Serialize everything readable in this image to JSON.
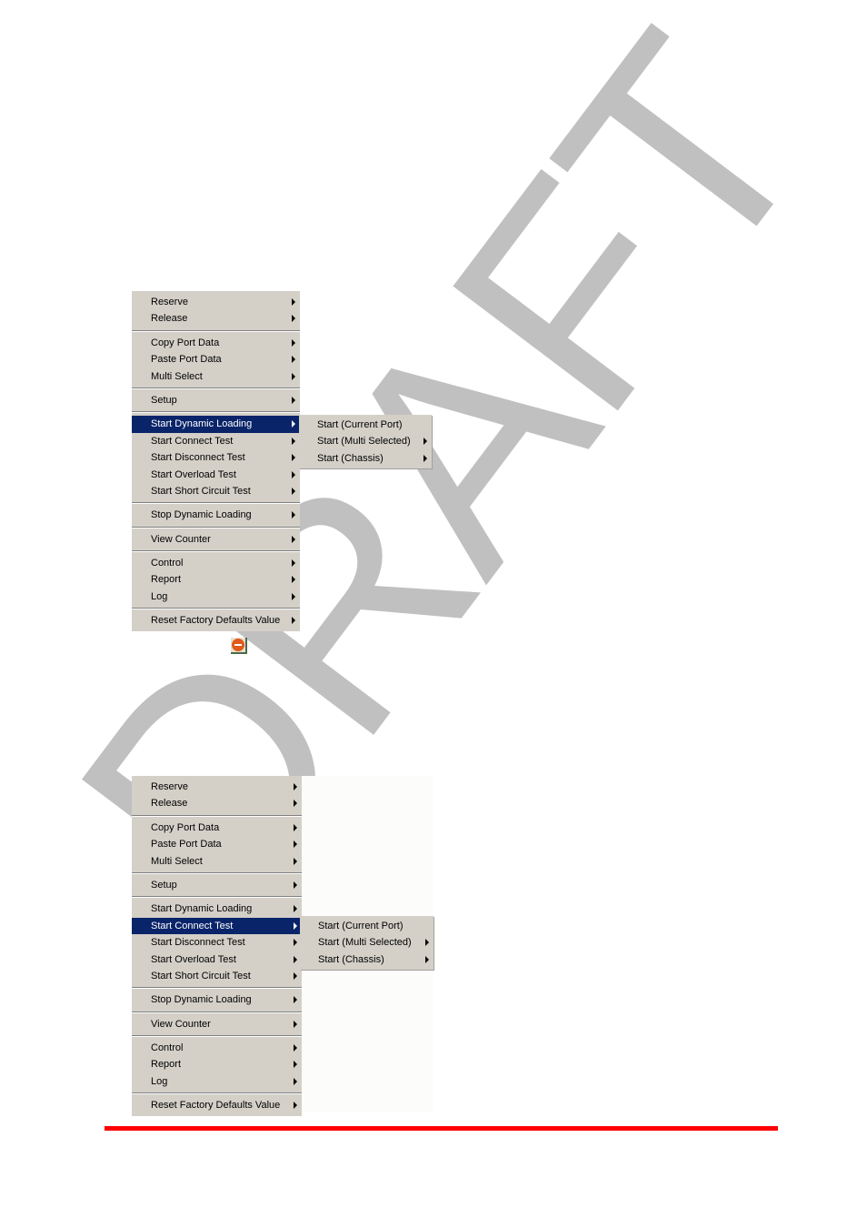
{
  "watermark": {
    "text": "DRAFT",
    "color": "#c0c0c0"
  },
  "screenshots": [
    {
      "menu": {
        "groups": [
          [
            {
              "label": "Reserve",
              "submenu": true
            },
            {
              "label": "Release",
              "submenu": true
            }
          ],
          [
            {
              "label": "Copy Port Data",
              "submenu": true
            },
            {
              "label": "Paste Port Data",
              "submenu": true
            },
            {
              "label": "Multi Select",
              "submenu": true
            }
          ],
          [
            {
              "label": "Setup",
              "submenu": true
            }
          ],
          [
            {
              "label": "Start Dynamic Loading",
              "submenu": true,
              "active": true
            },
            {
              "label": "Start Connect Test",
              "submenu": true
            },
            {
              "label": "Start Disconnect Test",
              "submenu": true
            },
            {
              "label": "Start Overload Test",
              "submenu": true
            },
            {
              "label": "Start Short Circuit Test",
              "submenu": true
            }
          ],
          [
            {
              "label": "Stop Dynamic Loading",
              "submenu": true
            }
          ],
          [
            {
              "label": "View Counter",
              "submenu": true
            }
          ],
          [
            {
              "label": "Control",
              "submenu": true
            },
            {
              "label": "Report",
              "submenu": true
            },
            {
              "label": "Log",
              "submenu": true
            }
          ],
          [
            {
              "label": "Reset Factory Defaults Value",
              "submenu": true
            }
          ]
        ]
      },
      "submenu": {
        "items": [
          {
            "label": "Start (Current Port)",
            "submenu": false
          },
          {
            "label": "Start (Multi Selected)",
            "submenu": true
          },
          {
            "label": "Start (Chassis)",
            "submenu": true
          }
        ]
      }
    },
    {
      "menu": {
        "groups": [
          [
            {
              "label": "Reserve",
              "submenu": true
            },
            {
              "label": "Release",
              "submenu": true
            }
          ],
          [
            {
              "label": "Copy Port Data",
              "submenu": true
            },
            {
              "label": "Paste Port Data",
              "submenu": true
            },
            {
              "label": "Multi Select",
              "submenu": true
            }
          ],
          [
            {
              "label": "Setup",
              "submenu": true
            }
          ],
          [
            {
              "label": "Start Dynamic Loading",
              "submenu": true
            },
            {
              "label": "Start Connect Test",
              "submenu": true,
              "active": true
            },
            {
              "label": "Start Disconnect Test",
              "submenu": true
            },
            {
              "label": "Start Overload Test",
              "submenu": true
            },
            {
              "label": "Start Short Circuit Test",
              "submenu": true
            }
          ],
          [
            {
              "label": "Stop Dynamic Loading",
              "submenu": true
            }
          ],
          [
            {
              "label": "View Counter",
              "submenu": true
            }
          ],
          [
            {
              "label": "Control",
              "submenu": true
            },
            {
              "label": "Report",
              "submenu": true
            },
            {
              "label": "Log",
              "submenu": true
            }
          ],
          [
            {
              "label": "Reset Factory Defaults Value",
              "submenu": true
            }
          ]
        ]
      },
      "submenu": {
        "items": [
          {
            "label": "Start (Current Port)",
            "submenu": false
          },
          {
            "label": "Start (Multi Selected)",
            "submenu": true
          },
          {
            "label": "Start (Chassis)",
            "submenu": true
          }
        ]
      }
    }
  ],
  "icons": {
    "stop": "stop-icon"
  },
  "colors": {
    "menu_bg": "#d4d0c8",
    "highlight": "#0a246a",
    "rule": "#ff0000"
  }
}
